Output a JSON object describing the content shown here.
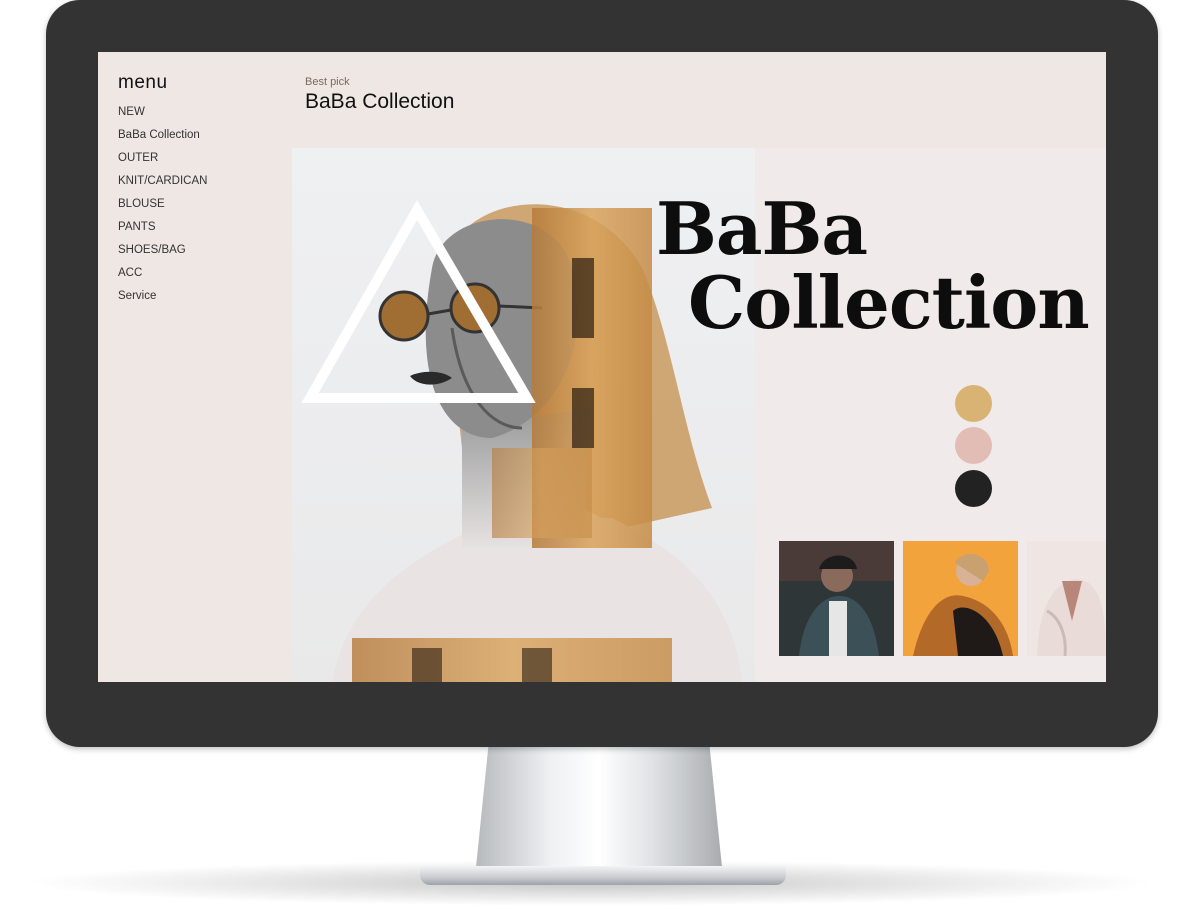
{
  "sidebar": {
    "title": "menu",
    "items": [
      {
        "label": "NEW"
      },
      {
        "label": "BaBa Collection"
      },
      {
        "label": "OUTER"
      },
      {
        "label": "KNIT/CARDICAN"
      },
      {
        "label": "BLOUSE"
      },
      {
        "label": "PANTS"
      },
      {
        "label": "SHOES/BAG"
      },
      {
        "label": "ACC"
      },
      {
        "label": "Service"
      }
    ]
  },
  "header": {
    "eyebrow": "Best pick",
    "title": "BaBa Collection"
  },
  "hero": {
    "title_line1": "BaBa",
    "title_line2": "Collection"
  },
  "color_swatches": [
    {
      "name": "gold",
      "color": "#d9b373"
    },
    {
      "name": "blush",
      "color": "#e1bdb6"
    },
    {
      "name": "black",
      "color": "#222222"
    }
  ],
  "thumbnails": [
    {
      "name": "denim-jacket-photo"
    },
    {
      "name": "orange-jacket-photo"
    },
    {
      "name": "white-shirt-photo"
    }
  ],
  "colors": {
    "screen_background": "#efe7e3",
    "monitor_bezel": "#333333"
  }
}
